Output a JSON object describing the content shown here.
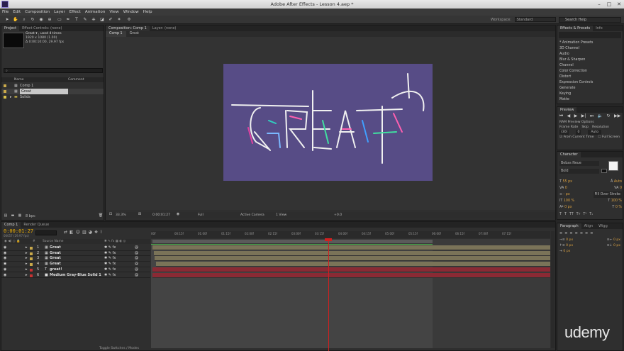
{
  "window": {
    "title": "Adobe After Effects - Lesson 4.aep *",
    "controls": [
      "–",
      "□",
      "✕"
    ]
  },
  "menu": [
    "File",
    "Edit",
    "Composition",
    "Layer",
    "Effect",
    "Animation",
    "View",
    "Window",
    "Help"
  ],
  "toolbar": {
    "workspace_label": "Workspace:",
    "workspace_value": "Standard",
    "search_placeholder": "Search Help"
  },
  "project": {
    "tabs": [
      "Project",
      "Effect Controls: (none)"
    ],
    "selected_name": "Great ▾ , used 4 times",
    "info": [
      "1920 x 1080 (1.00)",
      "Δ 0:00:10:00, 29.97 fps"
    ],
    "columns": {
      "name": "Name",
      "comment": "Comment"
    },
    "items": [
      {
        "name": "Comp 1",
        "color": "#c9a94a"
      },
      {
        "name": "Great",
        "color": "#c9a94a"
      },
      {
        "name": "Solids",
        "color": "#d9c14a"
      }
    ],
    "bpc": "8 bpc"
  },
  "composition": {
    "tabs": [
      "Composition: Comp 1",
      "Layer: (none)"
    ],
    "breadcrumbs": [
      "Comp 1",
      "Great"
    ],
    "bg_color": "#574c86",
    "bottom": {
      "zoom": "33.3%",
      "time": "0:00:01:27",
      "quality": "Full",
      "camera": "Active Camera",
      "views": "1 View",
      "offset": "+0.0"
    }
  },
  "effects": {
    "tabs": [
      "Effects & Presets",
      "Info"
    ],
    "items": [
      "* Animation Presets",
      "3D Channel",
      "Audio",
      "Blur & Sharpen",
      "Channel",
      "Color Correction",
      "Distort",
      "Expression Controls",
      "Generate",
      "Keying",
      "Matte"
    ]
  },
  "preview": {
    "tab": "Preview",
    "options_label": "RAM Preview Options",
    "frame_rate_label": "Frame Rate",
    "skip_label": "Skip",
    "resolution_label": "Resolution",
    "frame_rate": "(30)",
    "skip": "0",
    "resolution": "Auto",
    "from_current": "From Current Time",
    "full_screen": "Full Screen"
  },
  "character": {
    "tab": "Character",
    "font": "Bebas Neue",
    "style": "Bold",
    "size": "55 px",
    "leading": "Auto",
    "kerning": "0",
    "tracking": "0",
    "stroke_width": "- px",
    "stroke_mode": "Fill Over Stroke",
    "vscale": "100 %",
    "hscale": "100 %",
    "baseline": "0 px",
    "tsume": "0 %"
  },
  "paragraph": {
    "tabs": [
      "Paragraph",
      "Align",
      "Wigg"
    ],
    "indent_left": "0 px",
    "indent_right": "0 px",
    "space_before": "0 px",
    "space_after": "0 px",
    "first_indent": "0 px"
  },
  "timeline": {
    "tabs": [
      "Comp 1",
      "Render Queue"
    ],
    "time": "0:00:01:27",
    "frames": "00057 (29.97 fps)",
    "source_name_label": "Source Name",
    "ruler": [
      "00f",
      "00:15f",
      "01:00f",
      "01:15f",
      "02:00f",
      "02:15f",
      "03:00f",
      "03:15f",
      "04:00f",
      "04:15f",
      "05:00f",
      "05:15f",
      "06:00f",
      "06:15f",
      "07:00f",
      "07:15f"
    ],
    "layers": [
      {
        "num": "1",
        "name": "Great",
        "kind": "comp",
        "color": "#c9a94a",
        "bar": "#7a7358"
      },
      {
        "num": "2",
        "name": "Great",
        "kind": "comp",
        "color": "#c9a94a",
        "bar": "#7a7358"
      },
      {
        "num": "3",
        "name": "Great",
        "kind": "comp",
        "color": "#c9a94a",
        "bar": "#7a7358"
      },
      {
        "num": "4",
        "name": "Great",
        "kind": "comp",
        "color": "#c9a94a",
        "bar": "#7a7358"
      },
      {
        "num": "5",
        "name": "great!",
        "kind": "text",
        "color": "#c83232",
        "bar": "#8a2a34"
      },
      {
        "num": "6",
        "name": "Medium Gray-Blue Solid 1",
        "kind": "solid",
        "color": "#c83232",
        "bar": "#8a2a34"
      }
    ],
    "footer": "Toggle Switches / Modes"
  },
  "watermark": "udemy"
}
